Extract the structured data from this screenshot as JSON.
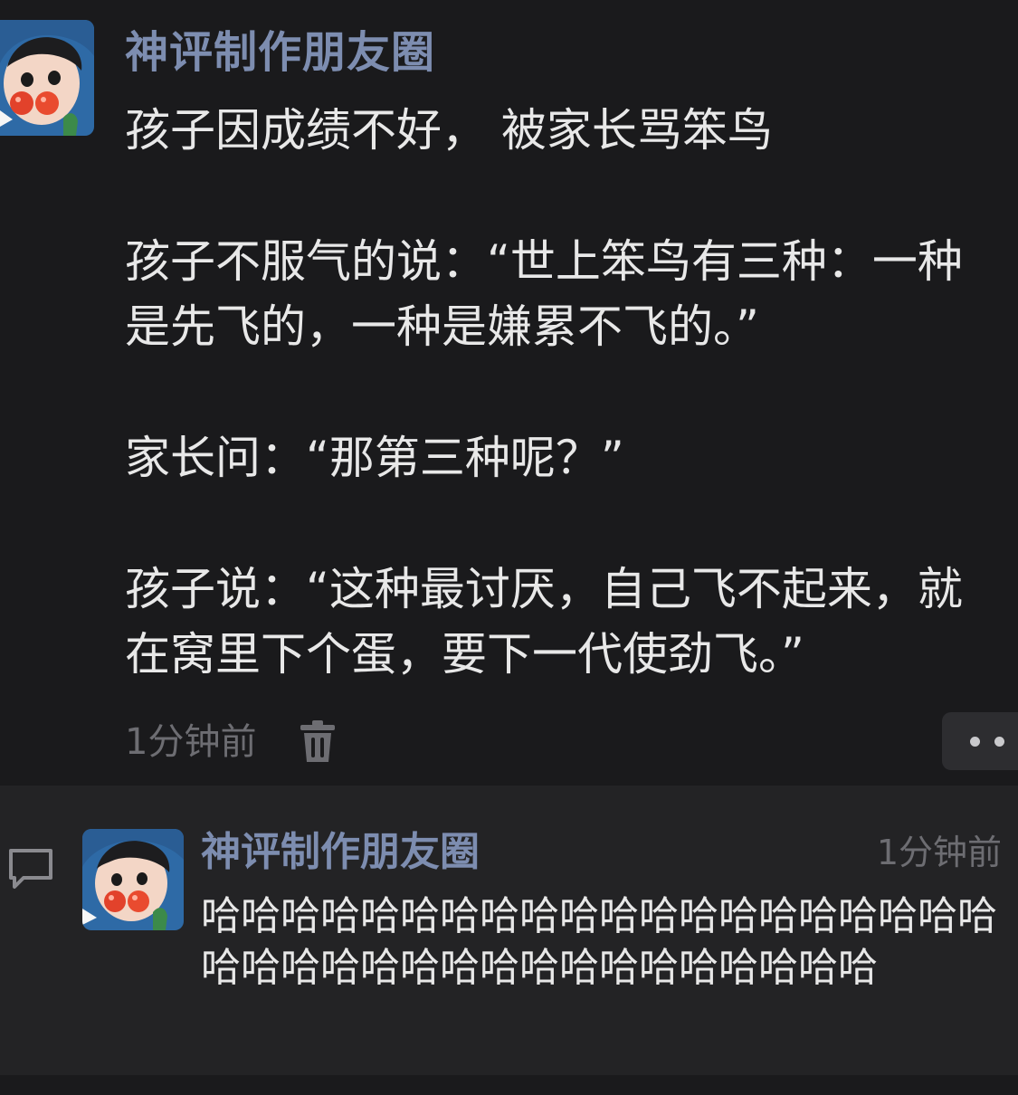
{
  "post": {
    "author": "神评制作朋友圈",
    "paragraphs": [
      "孩子因成绩不好， 被家长骂笨鸟",
      "孩子不服气的说：“世上笨鸟有三种：一种是先飞的，一种是嫌累不飞的。”",
      "家长问：“那第三种呢？”",
      "孩子说：“这种最讨厌，自己飞不起来，就在窝里下个蛋，要下一代使劲飞。”"
    ],
    "timestamp": "1分钟前",
    "icons": {
      "delete": "trash-icon",
      "more": "more-dots-icon"
    }
  },
  "comment": {
    "author": "神评制作朋友圈",
    "timestamp": "1分钟前",
    "text": "哈哈哈哈哈哈哈哈哈哈哈哈哈哈哈哈哈哈哈哈哈哈哈哈哈哈哈哈哈哈哈哈哈哈哈哈哈",
    "icon": "comment-bubble-icon"
  },
  "colors": {
    "background": "#1a1a1c",
    "comment_background": "#232325",
    "author_name": "#7d8db0",
    "text": "#e8e8e8",
    "muted": "#6d6d72"
  }
}
